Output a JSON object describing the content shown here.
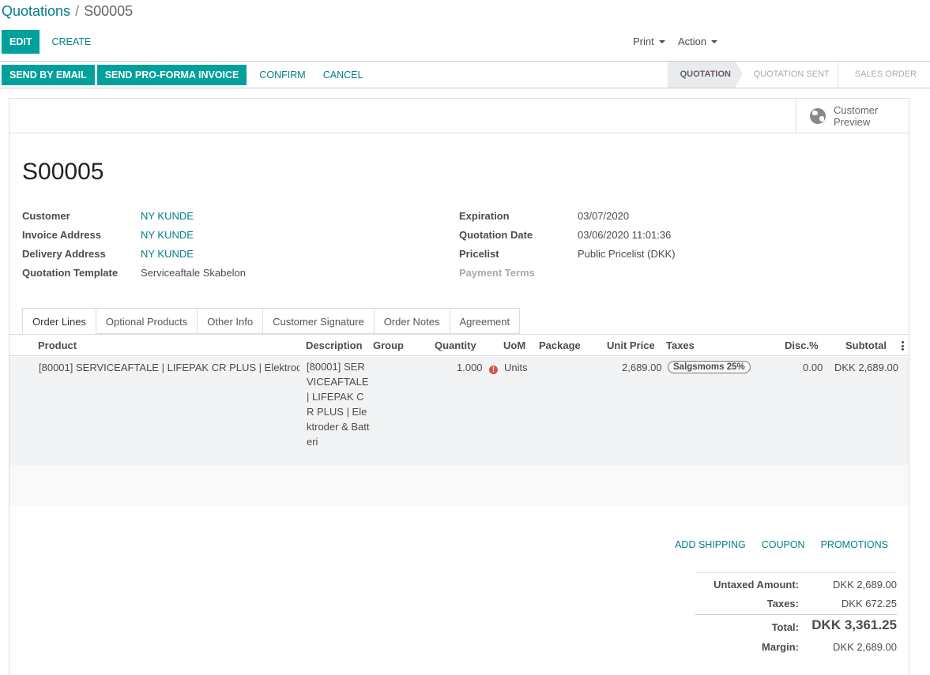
{
  "breadcrumb": {
    "parent": "Quotations",
    "separator": "/",
    "current": "S00005"
  },
  "toolbar": {
    "edit": "Edit",
    "create": "Create",
    "print": "Print",
    "action": "Action"
  },
  "statusbar": {
    "buttons": [
      "Send by Email",
      "Send PRO-FORMA Invoice"
    ],
    "links": [
      "Confirm",
      "Cancel"
    ],
    "stages": [
      "Quotation",
      "Quotation Sent",
      "Sales Order"
    ],
    "active_stage": "Quotation"
  },
  "smart_button": {
    "label_line1": "Customer",
    "label_line2": "Preview"
  },
  "record": {
    "name": "S00005",
    "left_fields": [
      {
        "label": "Customer",
        "value": "NY KUNDE",
        "is_link": true
      },
      {
        "label": "Invoice Address",
        "value": "NY KUNDE",
        "is_link": true
      },
      {
        "label": "Delivery Address",
        "value": "NY KUNDE",
        "is_link": true
      },
      {
        "label": "Quotation Template",
        "value": "Serviceaftale Skabelon",
        "is_link": false
      }
    ],
    "right_fields": [
      {
        "label": "Expiration",
        "value": "03/07/2020"
      },
      {
        "label": "Quotation Date",
        "value": "03/06/2020 11:01:36"
      },
      {
        "label": "Pricelist",
        "value": "Public Pricelist (DKK)"
      },
      {
        "label": "Payment Terms",
        "value": ""
      }
    ]
  },
  "tabs": [
    "Order Lines",
    "Optional Products",
    "Other Info",
    "Customer Signature",
    "Order Notes",
    "Agreement"
  ],
  "table": {
    "columns": [
      "Product",
      "Description",
      "Group",
      "Quantity",
      "UoM",
      "Package",
      "Unit Price",
      "Taxes",
      "Disc.%",
      "Subtotal"
    ],
    "row": {
      "product": "[80001] SERVICEAFTALE | LIFEPAK CR PLUS | Elektrode...",
      "description": "[80001] SERVICEAFTALE | LIFEPAK CR PLUS | Elektroder & Batteri",
      "quantity": "1.000",
      "warn_icon": "!",
      "uom": "Units",
      "unit_price": "2,689.00",
      "tax": "Salgsmoms 25%",
      "discount": "0.00",
      "subtotal": "DKK 2,689.00"
    }
  },
  "extra_links": [
    "Add Shipping",
    "Coupon",
    "Promotions"
  ],
  "totals": {
    "untaxed_label": "Untaxed Amount:",
    "untaxed": "DKK 2,689.00",
    "taxes_label": "Taxes:",
    "taxes": "DKK 672.25",
    "total_label": "Total:",
    "total": "DKK 3,361.25",
    "margin_label": "Margin:",
    "margin": "DKK 2,689.00"
  },
  "colors": {
    "primary": "#00a09d",
    "link": "#00808a"
  }
}
